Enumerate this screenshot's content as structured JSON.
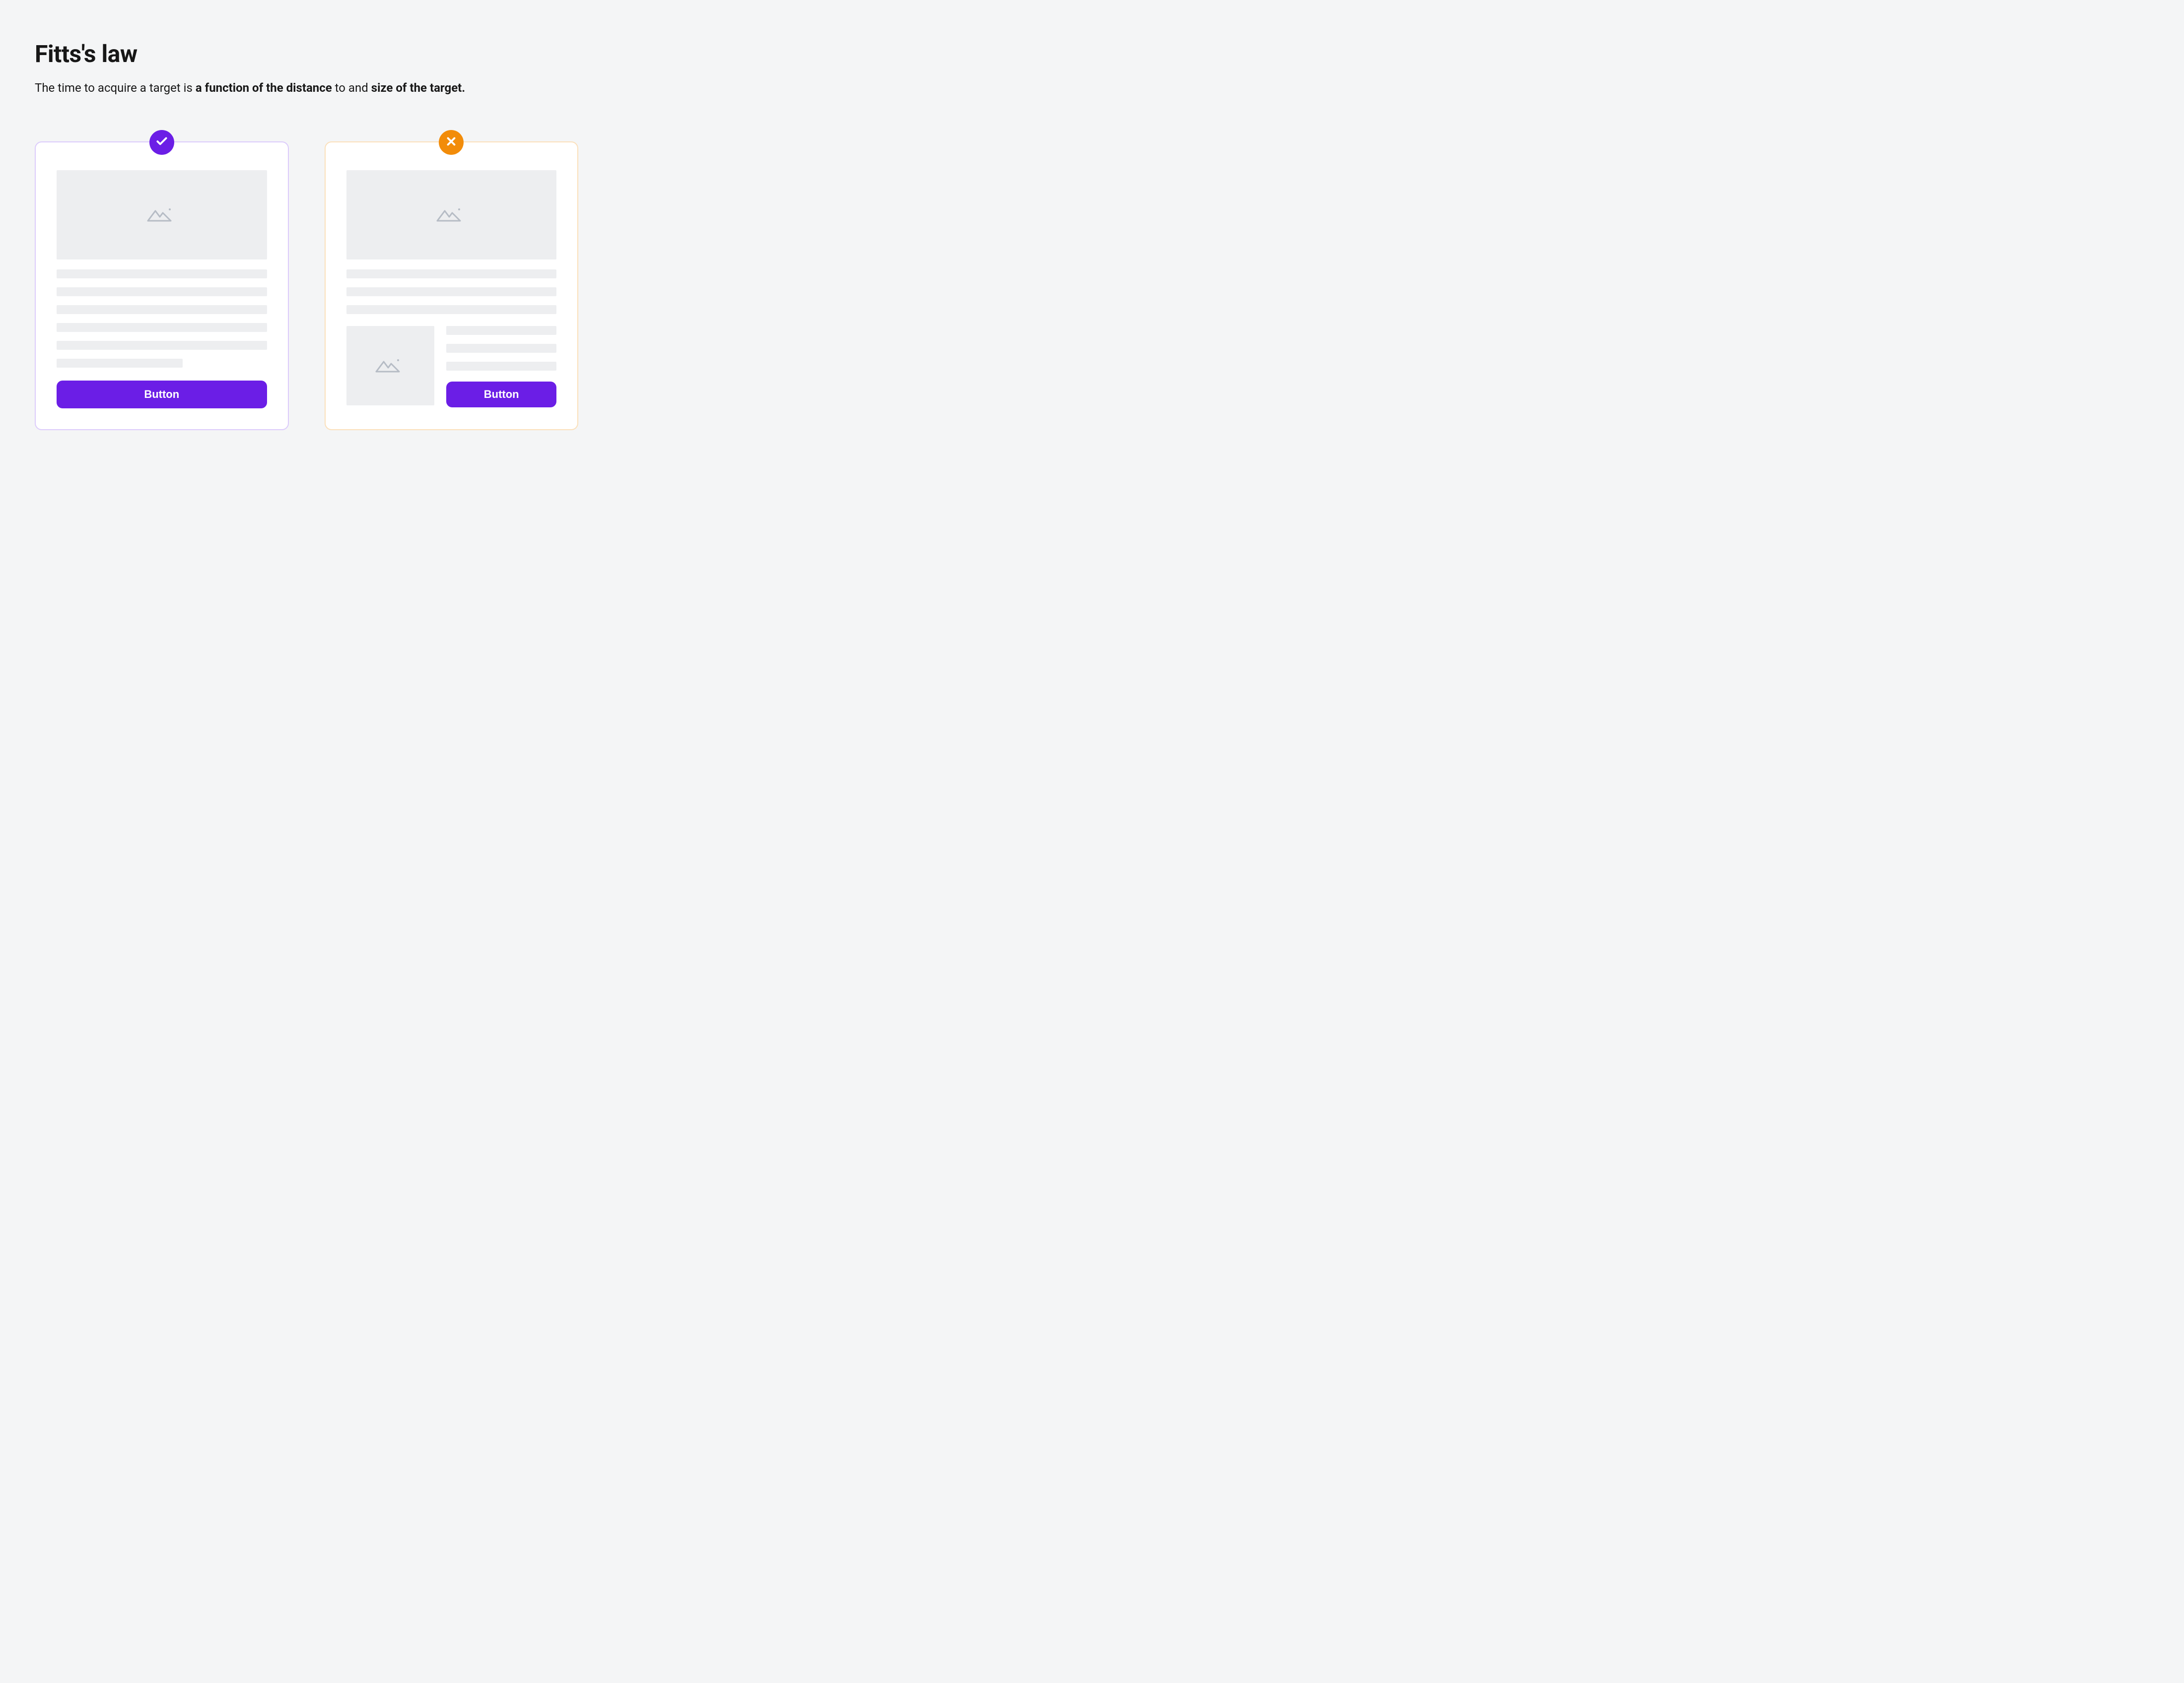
{
  "title": "Fitts's law",
  "subtitle": {
    "part1": "The time to acquire a target is ",
    "bold1": "a function of the distance",
    "part2": " to and ",
    "bold2": "size of the target."
  },
  "examples": {
    "good": {
      "status": "correct",
      "button_label": "Button"
    },
    "bad": {
      "status": "incorrect",
      "button_label": "Button"
    }
  },
  "colors": {
    "accent": "#6b1ee6",
    "good_border": "#dcccfb",
    "bad_badge": "#f28c0a",
    "bad_border": "#fbe0bb",
    "placeholder": "#edeef0"
  }
}
